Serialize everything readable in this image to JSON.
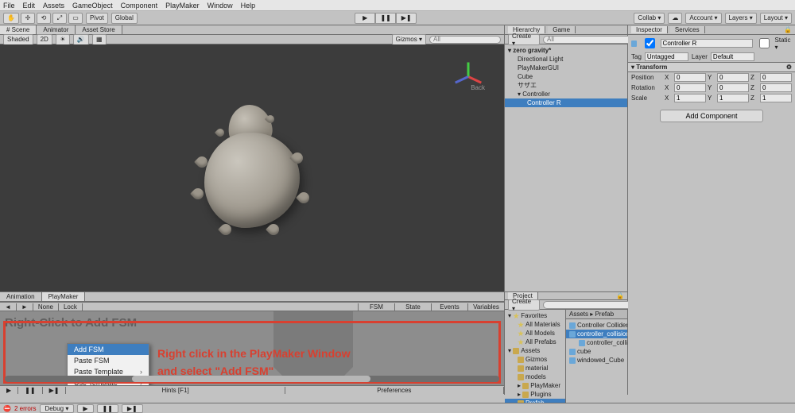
{
  "menubar": [
    "File",
    "Edit",
    "Assets",
    "GameObject",
    "Component",
    "PlayMaker",
    "Window",
    "Help"
  ],
  "toolbar": {
    "pivot": "Pivot",
    "global": "Global",
    "collab": "Collab ▾",
    "account": "Account ▾",
    "layers": "Layers ▾",
    "layout": "Layout ▾"
  },
  "scene": {
    "tabs": [
      "# Scene",
      "Animator",
      "Asset Store"
    ],
    "shaded": "Shaded",
    "mode2d": "2D",
    "gizmos": "Gizmos ▾",
    "search_ph": "All",
    "back": "Back"
  },
  "hierarchy": {
    "tabs": [
      "Hierarchy",
      "Game"
    ],
    "create": "Create ▾",
    "search_ph": "All",
    "root": "zero gravity*",
    "items": [
      "Directional Light",
      "PlayMakerGUI",
      "Cube",
      "サザエ"
    ],
    "controller": "Controller",
    "controller_child": "Controller R"
  },
  "project": {
    "tab": "Project",
    "create": "Create ▾",
    "search_ph": "",
    "favorites": "Favorites",
    "fav_items": [
      "All Materials",
      "All Models",
      "All Prefabs"
    ],
    "assets": "Assets",
    "folders": [
      "Gizmos",
      "material",
      "models",
      "PlayMaker",
      "Plugins",
      "Prefab"
    ],
    "right_header": "Assets ▸ Prefab",
    "right_items": [
      "Controller Collider",
      "controller_collision_test",
      "controller_collision_L",
      "cube",
      "windowed_Cube"
    ]
  },
  "inspector": {
    "tabs": [
      "Inspector",
      "Services"
    ],
    "name": "Controller R",
    "static": "Static ▾",
    "tag_label": "Tag",
    "tag_value": "Untagged",
    "layer_label": "Layer",
    "layer_value": "Default",
    "transform": "Transform",
    "position": "Position",
    "rotation": "Rotation",
    "scale": "Scale",
    "pos": {
      "x": "0",
      "y": "0",
      "z": "0"
    },
    "rot": {
      "x": "0",
      "y": "0",
      "z": "0"
    },
    "scl": {
      "x": "1",
      "y": "1",
      "z": "1"
    },
    "add_component": "Add Component"
  },
  "playmaker": {
    "tabs": [
      "Animation",
      "PlayMaker"
    ],
    "none": "None",
    "lock": "Lock",
    "right_tabs": [
      "FSM",
      "State",
      "Events",
      "Variables"
    ],
    "hint": "Right-Click to Add FSM",
    "context": [
      "Add FSM",
      "Paste FSM",
      "Paste Template",
      "Use Template"
    ],
    "annotation1": "Right click in the PlayMaker Window",
    "annotation2": "and select \"Add FSM\"",
    "footer_hints": "Hints [F1]",
    "footer_prefs": "Preferences"
  },
  "status": {
    "errors": "2 errors",
    "debug": "Debug ▾"
  }
}
